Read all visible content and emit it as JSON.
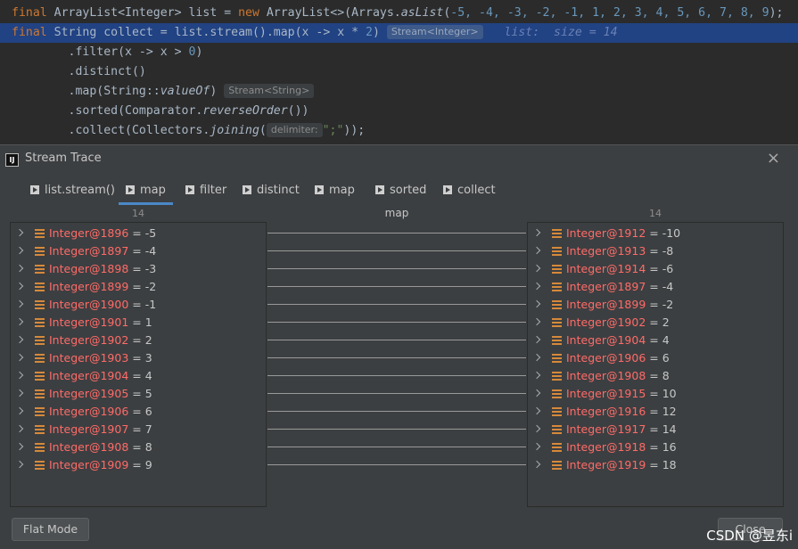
{
  "editor": {
    "line1": {
      "kw": "final",
      "type": " ArrayList<Integer> list = ",
      "new": "new",
      "ctor": " ArrayList<>(Arrays.",
      "method": "asList",
      "open": "(",
      "args": "-5, -4, -3, -2, -1, 1, 2, 3, 4, 5, 6, 7, 8, 9",
      "close": ");"
    },
    "line2": {
      "kw": "final",
      "text": " String collect = list.stream().map(x -> x * ",
      "num": "2",
      "close": ")",
      "hint": "Stream<Integer>",
      "debug": "list:  size = 14"
    },
    "line3": {
      "prefix": "        .filter(x -> x > ",
      "num": "0",
      "close": ")"
    },
    "line4": {
      "text": "        .distinct()"
    },
    "line5": {
      "prefix": "        .map(String::",
      "method": "valueOf",
      "close": ")",
      "hint": "Stream<String>"
    },
    "line6": {
      "prefix": "        .sorted(Comparator.",
      "method": "reverseOrder",
      "close": "())"
    },
    "line7": {
      "prefix": "        .collect(Collectors.",
      "method": "joining",
      "open": "(",
      "hint": "delimiter:",
      "str": "\";\"",
      "close": "));"
    }
  },
  "dialog": {
    "title": "Stream Trace",
    "app_icon": "IJ",
    "close_symbol": "×",
    "tabs": [
      {
        "label": "list.stream()",
        "icon": "play-triangle-icon"
      },
      {
        "label": "map",
        "icon": "play-triangle-icon",
        "selected": true
      },
      {
        "label": "filter",
        "icon": "play-triangle-icon"
      },
      {
        "label": "distinct",
        "icon": "play-triangle-icon"
      },
      {
        "label": "map",
        "icon": "play-triangle-icon"
      },
      {
        "label": "sorted",
        "icon": "play-triangle-icon"
      },
      {
        "label": "collect",
        "icon": "play-triangle-icon"
      }
    ],
    "left_count": "14",
    "right_count": "14",
    "operation": "map",
    "left_items": [
      {
        "name": "Integer@1896",
        "eq": " = ",
        "value": "-5"
      },
      {
        "name": "Integer@1897",
        "eq": " = ",
        "value": "-4"
      },
      {
        "name": "Integer@1898",
        "eq": " = ",
        "value": "-3"
      },
      {
        "name": "Integer@1899",
        "eq": " = ",
        "value": "-2"
      },
      {
        "name": "Integer@1900",
        "eq": " = ",
        "value": "-1"
      },
      {
        "name": "Integer@1901",
        "eq": " = ",
        "value": "1"
      },
      {
        "name": "Integer@1902",
        "eq": " = ",
        "value": "2"
      },
      {
        "name": "Integer@1903",
        "eq": " = ",
        "value": "3"
      },
      {
        "name": "Integer@1904",
        "eq": " = ",
        "value": "4"
      },
      {
        "name": "Integer@1905",
        "eq": " = ",
        "value": "5"
      },
      {
        "name": "Integer@1906",
        "eq": " = ",
        "value": "6"
      },
      {
        "name": "Integer@1907",
        "eq": " = ",
        "value": "7"
      },
      {
        "name": "Integer@1908",
        "eq": " = ",
        "value": "8"
      },
      {
        "name": "Integer@1909",
        "eq": " = ",
        "value": "9"
      }
    ],
    "right_items": [
      {
        "name": "Integer@1912",
        "eq": " = ",
        "value": "-10"
      },
      {
        "name": "Integer@1913",
        "eq": " = ",
        "value": "-8"
      },
      {
        "name": "Integer@1914",
        "eq": " = ",
        "value": "-6"
      },
      {
        "name": "Integer@1897",
        "eq": " = ",
        "value": "-4"
      },
      {
        "name": "Integer@1899",
        "eq": " = ",
        "value": "-2"
      },
      {
        "name": "Integer@1902",
        "eq": " = ",
        "value": "2"
      },
      {
        "name": "Integer@1904",
        "eq": " = ",
        "value": "4"
      },
      {
        "name": "Integer@1906",
        "eq": " = ",
        "value": "6"
      },
      {
        "name": "Integer@1908",
        "eq": " = ",
        "value": "8"
      },
      {
        "name": "Integer@1915",
        "eq": " = ",
        "value": "10"
      },
      {
        "name": "Integer@1916",
        "eq": " = ",
        "value": "12"
      },
      {
        "name": "Integer@1917",
        "eq": " = ",
        "value": "14"
      },
      {
        "name": "Integer@1918",
        "eq": " = ",
        "value": "16"
      },
      {
        "name": "Integer@1919",
        "eq": " = ",
        "value": "18"
      }
    ],
    "flat_mode_label": "Flat Mode",
    "close_label": "Close"
  },
  "watermark": "CSDN @昱东i",
  "colors": {
    "accent": "#4a88c7",
    "item_name": "#ff6b68",
    "field_icon": "#d6893b",
    "selection": "#214283"
  }
}
